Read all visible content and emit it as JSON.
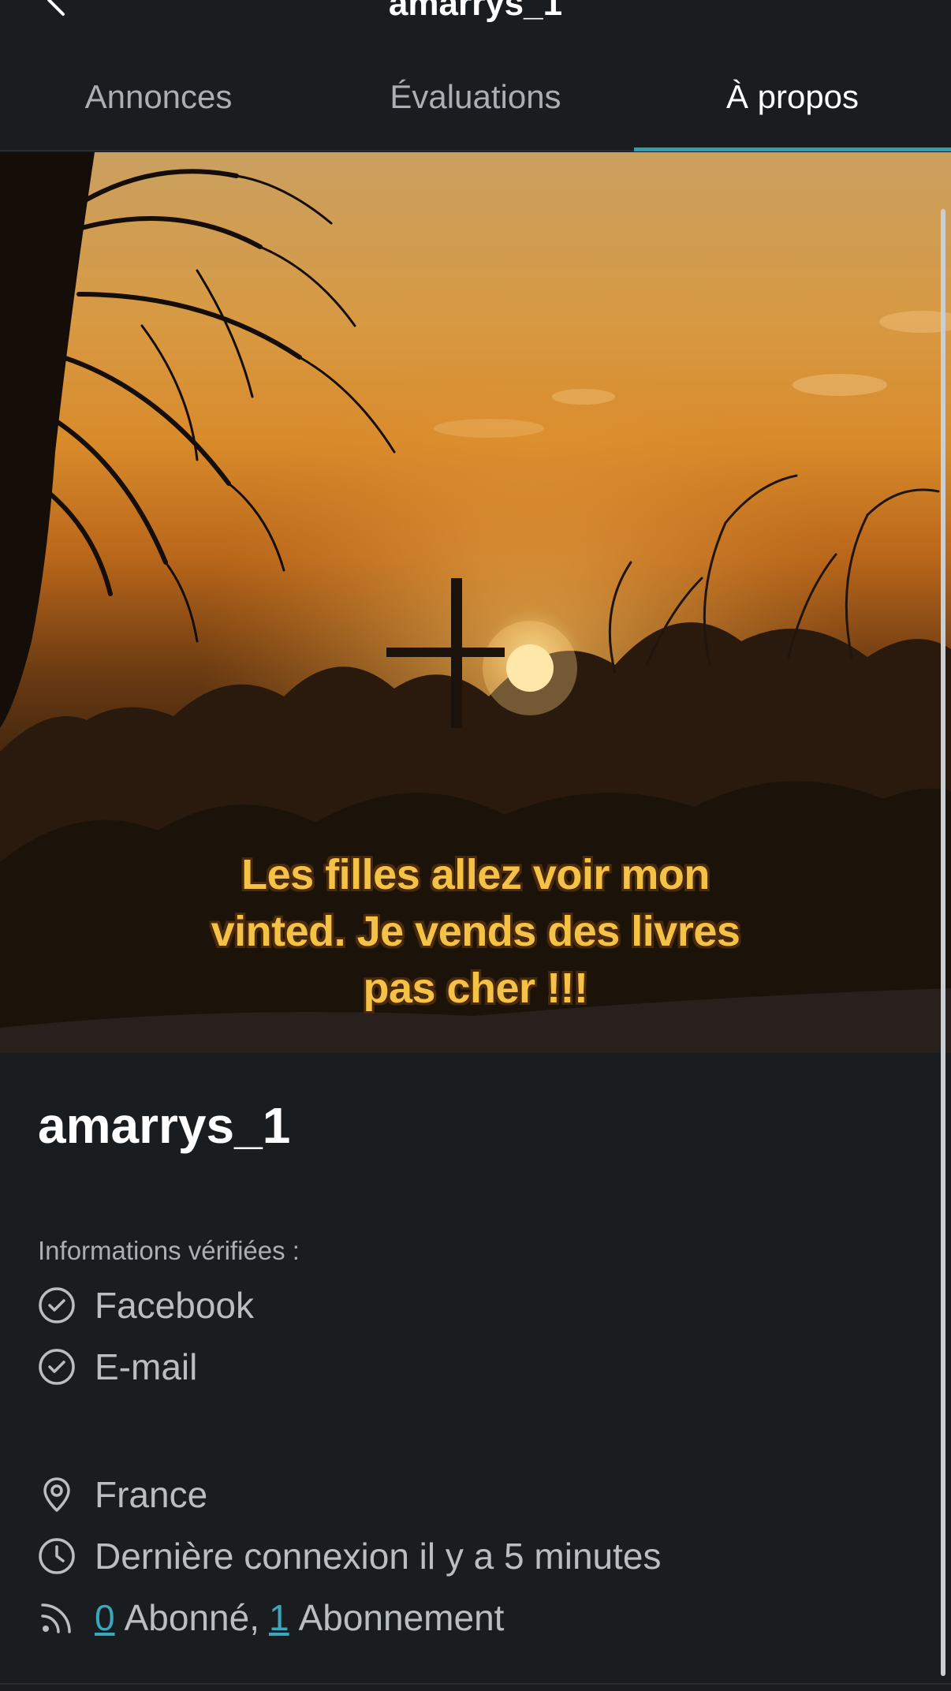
{
  "header": {
    "title": "amarrys_1",
    "back_icon": "chevron-left-icon"
  },
  "tabs": [
    {
      "label": "Annonces",
      "active": false
    },
    {
      "label": "Évaluations",
      "active": false
    },
    {
      "label": "À propos",
      "active": true
    }
  ],
  "banner": {
    "caption": "Les filles allez voir mon vinted. Je vends des livres pas cher !!!"
  },
  "profile": {
    "username": "amarrys_1",
    "verified_label": "Informations vérifiées :",
    "verified": [
      {
        "icon": "check-circle-icon",
        "label": "Facebook"
      },
      {
        "icon": "check-circle-icon",
        "label": "E-mail"
      }
    ],
    "location": {
      "icon": "location-pin-icon",
      "label": "France"
    },
    "last_seen": {
      "icon": "clock-icon",
      "label": "Dernière connexion il y a 5 minutes"
    },
    "follow": {
      "icon": "rss-icon",
      "followers_count": "0",
      "followers_label": "Abonné,",
      "following_count": "1",
      "following_label": "Abonnement"
    }
  },
  "colors": {
    "background": "#1a1d20",
    "accent": "#2f9fb0",
    "link": "#3aa7bd",
    "caption": "#f4c246"
  }
}
